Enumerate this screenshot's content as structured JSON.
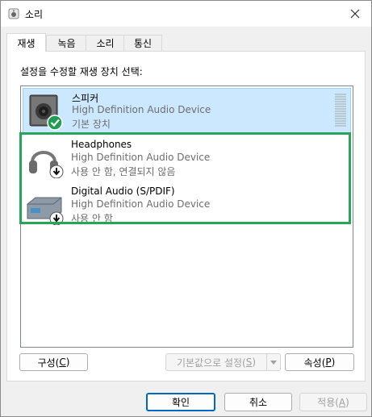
{
  "window": {
    "title": "소리"
  },
  "tabs": [
    {
      "label": "재생",
      "active": true
    },
    {
      "label": "녹음",
      "active": false
    },
    {
      "label": "소리",
      "active": false
    },
    {
      "label": "통신",
      "active": false
    }
  ],
  "instruction": "설정을 수정할 재생 장치 선택:",
  "devices": [
    {
      "name": "스피커",
      "description": "High Definition Audio Device",
      "status": "기본 장치",
      "selected": true,
      "badge": "check-icon"
    },
    {
      "name": "Headphones",
      "description": "High Definition Audio Device",
      "status": "사용 안 함, 연결되지 않음",
      "selected": false,
      "badge": "down-arrow-icon"
    },
    {
      "name": "Digital Audio (S/PDIF)",
      "description": "High Definition Audio Device",
      "status": "사용 안 함",
      "selected": false,
      "badge": "down-arrow-icon"
    }
  ],
  "buttons": {
    "configure": {
      "label": "구성(",
      "hotkey": "C",
      "suffix": ")"
    },
    "set_default": {
      "label": "기본값으로 설정(",
      "hotkey": "S",
      "suffix": ")",
      "disabled": true
    },
    "properties": {
      "label": "속성(",
      "hotkey": "P",
      "suffix": ")"
    },
    "ok": {
      "label": "확인"
    },
    "cancel": {
      "label": "취소"
    },
    "apply": {
      "label": "적용(",
      "hotkey": "A",
      "suffix": ")",
      "disabled": true
    }
  },
  "colors": {
    "selection_bg": "#cce8ff",
    "highlight_border": "#27a659",
    "accent": "#0067c0"
  }
}
